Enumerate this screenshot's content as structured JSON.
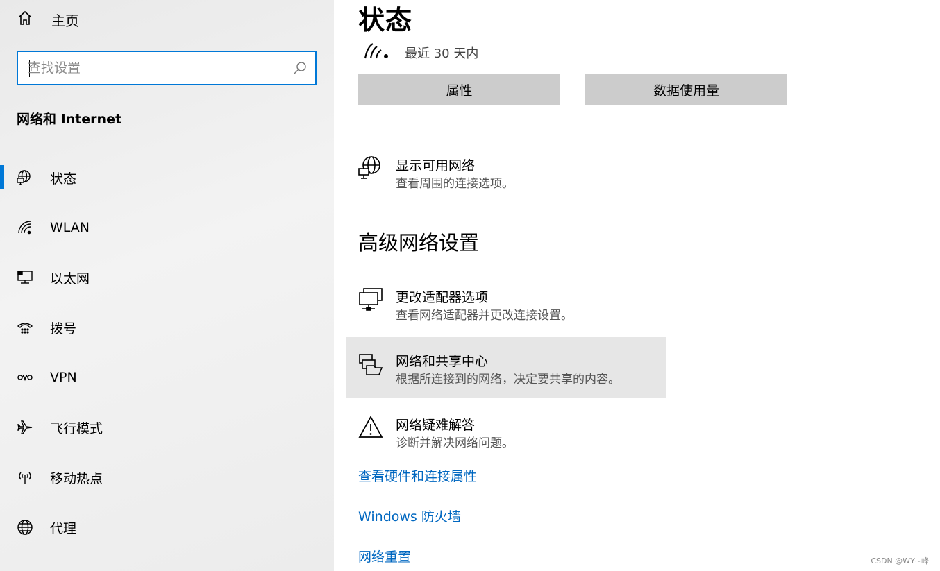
{
  "sidebar": {
    "home_label": "主页",
    "search_placeholder": "查找设置",
    "section_title": "网络和 Internet",
    "items": [
      {
        "label": "状态",
        "icon": "globe-monitor-icon",
        "active": true
      },
      {
        "label": "WLAN",
        "icon": "wifi-icon"
      },
      {
        "label": "以太网",
        "icon": "ethernet-icon"
      },
      {
        "label": "拨号",
        "icon": "dialup-icon"
      },
      {
        "label": "VPN",
        "icon": "vpn-icon"
      },
      {
        "label": "飞行模式",
        "icon": "airplane-icon"
      },
      {
        "label": "移动热点",
        "icon": "hotspot-icon"
      },
      {
        "label": "代理",
        "icon": "globe-icon"
      }
    ]
  },
  "main": {
    "title": "状态",
    "usage_text": "最近 30 天内",
    "buttons": {
      "properties": "属性",
      "data_usage": "数据使用量"
    },
    "show_networks": {
      "title": "显示可用网络",
      "desc": "查看周围的连接选项。"
    },
    "advanced_title": "高级网络设置",
    "options": [
      {
        "title": "更改适配器选项",
        "desc": "查看网络适配器并更改连接设置。"
      },
      {
        "title": "网络和共享中心",
        "desc": "根据所连接到的网络，决定要共享的内容。"
      },
      {
        "title": "网络疑难解答",
        "desc": "诊断并解决网络问题。"
      }
    ],
    "links": [
      "查看硬件和连接属性",
      "Windows 防火墙",
      "网络重置"
    ]
  },
  "watermark": "CSDN @WY~峰",
  "colors": {
    "accent": "#0078d7",
    "link": "#0067c0",
    "button_bg": "#cccccc",
    "hover_bg": "#e6e6e6"
  }
}
